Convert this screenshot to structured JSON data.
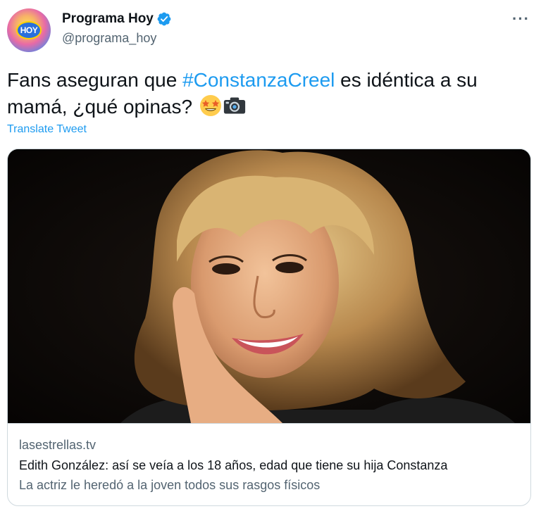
{
  "author": {
    "display_name": "Programa Hoy",
    "handle": "@programa_hoy",
    "avatar_logo_text": "HOY",
    "verified": true
  },
  "tweet": {
    "text_before": "Fans aseguran que ",
    "hashtag": "#ConstanzaCreel",
    "text_after": " es idéntica a su mamá, ¿qué opinas?",
    "emojis": [
      "star-struck-icon",
      "camera-icon"
    ],
    "translate_label": "Translate Tweet",
    "more_label": "···"
  },
  "card": {
    "domain": "lasestrellas.tv",
    "title": "Edith González: así se veía a los 18 años, edad que tiene su hija Constanza",
    "description": "La actriz le heredó a la joven todos sus rasgos físicos"
  },
  "colors": {
    "accent": "#1d9bf0",
    "text_primary": "#0f1419",
    "text_secondary": "#536471",
    "border": "#cfd9de"
  }
}
